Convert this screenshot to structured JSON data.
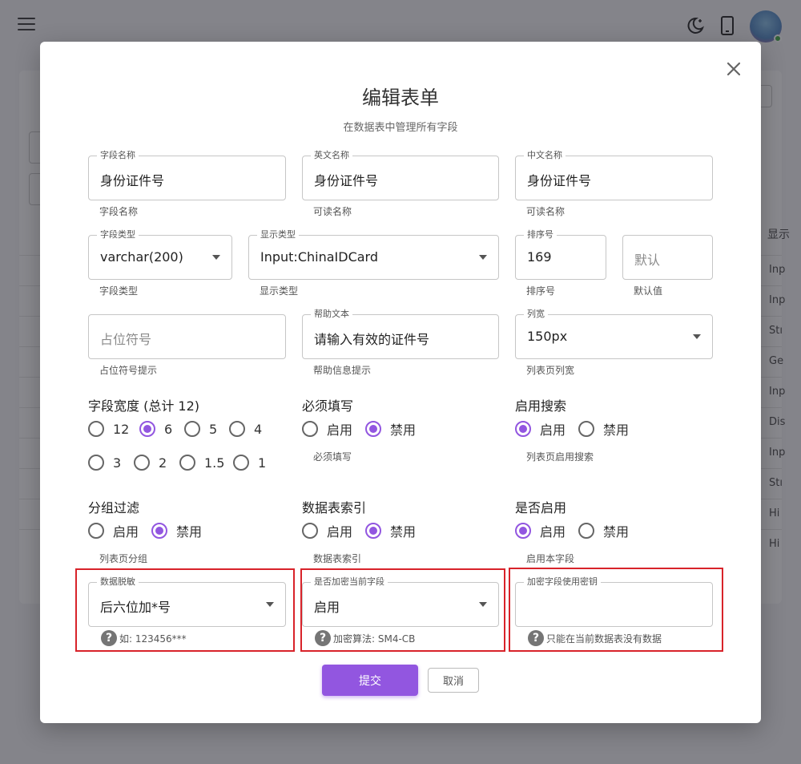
{
  "modal": {
    "title": "编辑表单",
    "subtitle": "在数据表中管理所有字段"
  },
  "fields": {
    "field_name": {
      "label": "字段名称",
      "value": "身份证件号",
      "helper": "字段名称"
    },
    "english_name": {
      "label": "英文名称",
      "value": "身份证件号",
      "helper": "可读名称"
    },
    "chinese_name": {
      "label": "中文名称",
      "value": "身份证件号",
      "helper": "可读名称"
    },
    "field_type": {
      "label": "字段类型",
      "value": "varchar(200)",
      "helper": "字段类型"
    },
    "display_type": {
      "label": "显示类型",
      "value": "Input:ChinaIDCard",
      "helper": "显示类型"
    },
    "sort_order": {
      "label": "排序号",
      "value": "169",
      "helper": "排序号"
    },
    "default_value": {
      "placeholder": "默认",
      "helper": "默认值"
    },
    "placeholder_text": {
      "placeholder": "占位符号",
      "helper": "占位符号提示"
    },
    "help_text": {
      "label": "帮助文本",
      "value": "请输入有效的证件号",
      "helper": "帮助信息提示"
    },
    "column_width": {
      "label": "列宽",
      "value": "150px",
      "helper": "列表页列宽"
    }
  },
  "field_width": {
    "title": "字段宽度 (总计 12)",
    "options": [
      "12",
      "6",
      "5",
      "4",
      "3",
      "2",
      "1.5",
      "1"
    ],
    "selected": "6"
  },
  "required": {
    "title": "必须填写",
    "options": [
      "启用",
      "禁用"
    ],
    "selected": "禁用",
    "helper": "必须填写"
  },
  "enable_search": {
    "title": "启用搜索",
    "options": [
      "启用",
      "禁用"
    ],
    "selected": "启用",
    "helper": "列表页启用搜索"
  },
  "group_filter": {
    "title": "分组过滤",
    "options": [
      "启用",
      "禁用"
    ],
    "selected": "禁用",
    "helper": "列表页分组"
  },
  "table_index": {
    "title": "数据表索引",
    "options": [
      "启用",
      "禁用"
    ],
    "selected": "禁用",
    "helper": "数据表索引"
  },
  "is_enabled": {
    "title": "是否启用",
    "options": [
      "启用",
      "禁用"
    ],
    "selected": "启用",
    "helper": "启用本字段"
  },
  "masking": {
    "label": "数据脱敏",
    "value": "后六位加*号",
    "help": "如: 123456***"
  },
  "encrypt": {
    "label": "是否加密当前字段",
    "value": "启用",
    "help": "加密算法: SM4-CB"
  },
  "encrypt_key": {
    "label": "加密字段使用密钥",
    "help": "只能在当前数据表没有数据"
  },
  "buttons": {
    "submit": "提交",
    "cancel": "取消"
  },
  "background": {
    "column_header": "显示",
    "rows": [
      "Inp",
      "Inp",
      "Stı",
      "Ge",
      "Inp",
      "Dis",
      "Inp",
      "Stı",
      "Hi",
      "Hi"
    ]
  },
  "colors": {
    "accent": "#9256e0",
    "highlight_border": "#d8232a",
    "overlay": "rgba(20,20,30,0.5)"
  }
}
